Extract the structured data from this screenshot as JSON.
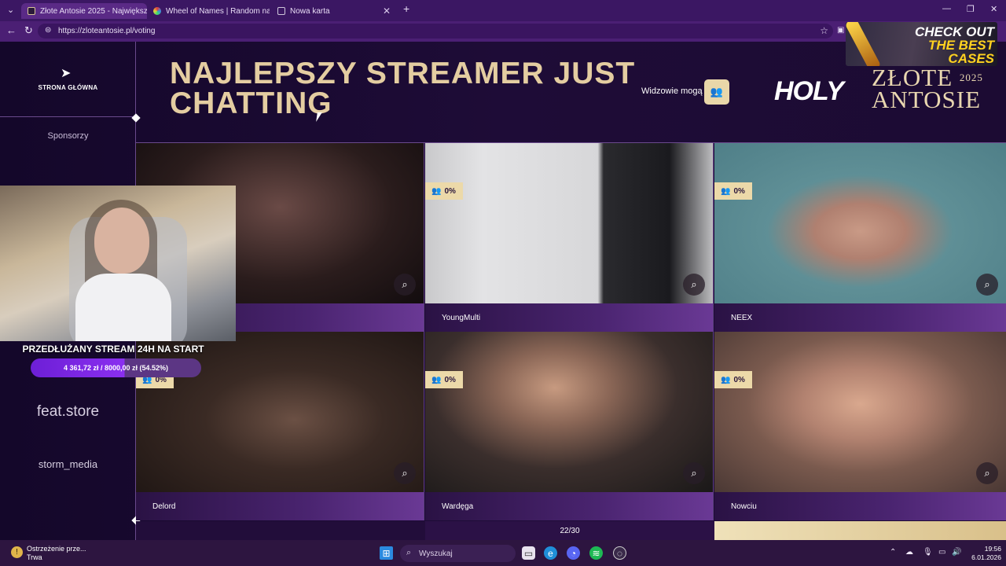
{
  "browser": {
    "tabs": [
      {
        "title": "Złote Antosie 2025 - Największy P",
        "favicon_color": "#2a1a3a"
      },
      {
        "title": "Wheel of Names | Random name p",
        "favicon_color": "#e23c3c"
      },
      {
        "title": "Nowa karta",
        "favicon_color": "#cfc6da"
      }
    ],
    "url": "https://zloteantosie.pl/voting"
  },
  "sidebar": {
    "home_label": "STRONA GŁÓWNA",
    "sponsors_heading": "Sponsorzy",
    "sponsors": [
      "feat.store",
      "storm_media"
    ]
  },
  "header": {
    "title": "NAJLEPSZY STREAMER JUST CHATTING",
    "viewers_label": "Widzowie mogą",
    "brand_holy": "HOLY",
    "brand_zlote": "ZŁOTE",
    "brand_antosie": "ANTOSIE",
    "brand_year": "2025"
  },
  "nominees": [
    {
      "name": "",
      "percent": "",
      "bg": "#2a1c1c"
    },
    {
      "name": "YoungMulti",
      "percent": "0%",
      "bg": "#2c2c30"
    },
    {
      "name": "NEEX",
      "percent": "0%",
      "bg": "#4f7f88"
    },
    {
      "name": "Delord",
      "percent": "0%",
      "bg": "#231a18"
    },
    {
      "name": "Wardęga",
      "percent": "0%",
      "bg": "#3a2e2c"
    },
    {
      "name": "Nowciu",
      "percent": "0%",
      "bg": "#7a5a4e"
    }
  ],
  "pager": "22/30",
  "stream_overlay": {
    "caption": "PRZEDŁUŻANY STREAM 24H NA START",
    "goal_text": "4 361,72 zł / 8000,00 zł (54.52%)",
    "goal_fraction": 0.5452
  },
  "ad": {
    "line1": "CHECK OUT",
    "line2": "THE BEST",
    "line3": "CASES"
  },
  "taskbar": {
    "notification_title": "Ostrzeżenie prze...",
    "notification_sub": "Trwa",
    "search_placeholder": "Wyszukaj",
    "time": "19:56",
    "date": "6.01.2026"
  }
}
